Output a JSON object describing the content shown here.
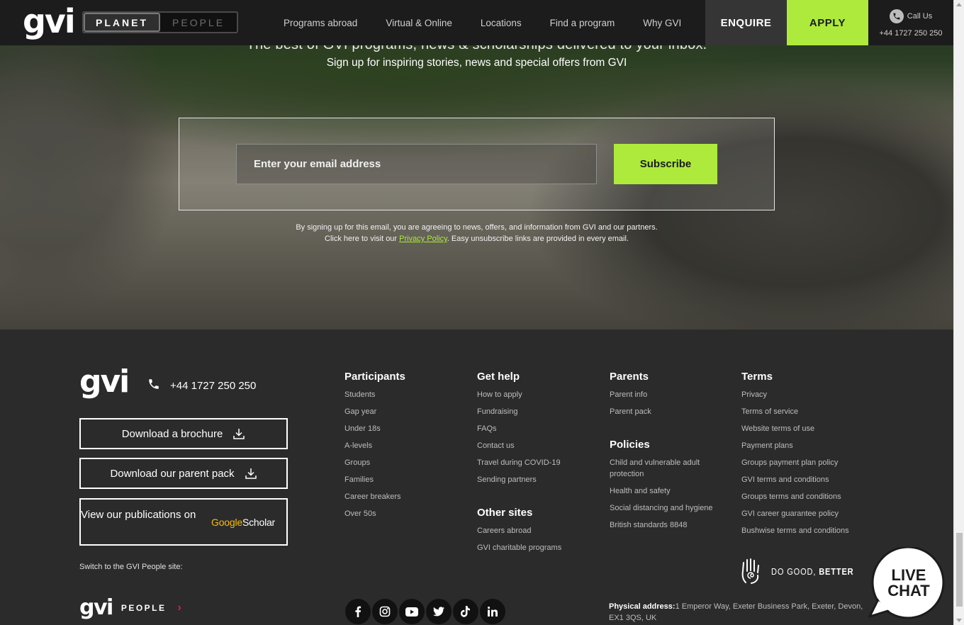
{
  "header": {
    "logo": "gvi",
    "toggle": {
      "active": "PLANET",
      "inactive": "PEOPLE"
    },
    "nav": [
      "Programs abroad",
      "Virtual & Online",
      "Locations",
      "Find a program",
      "Why GVI"
    ],
    "enquire": "ENQUIRE",
    "apply": "APPLY",
    "call_label": "Call Us",
    "call_number": "+44 1727 250 250"
  },
  "hero": {
    "title": "The best of GVI programs, news & scholarships delivered to your inbox.",
    "subtitle": "Sign up for inspiring stories, news and special offers from GVI",
    "email_placeholder": "Enter your email address",
    "subscribe": "Subscribe",
    "legal_line1": "By signing up for this email, you are agreeing to news, offers, and information from GVI and our partners.",
    "legal_line2_pre": "Click here to visit our",
    "privacy_link": "Privacy Policy",
    "legal_line2_post": ". Easy unsubscribe links are provided in every email."
  },
  "footer": {
    "logo": "gvi",
    "phone": "+44 1727 250 250",
    "brochure_btn": "Download a brochure",
    "parent_pack_btn": "Download our parent pack",
    "publications_text": "View our publications on",
    "scholar_google": "Google",
    "scholar_word": "Scholar",
    "switch_label": "Switch to the GVI People site:",
    "people_logo": "gvi",
    "people_text": "PEOPLE",
    "columns": {
      "participants": {
        "title": "Participants",
        "links": [
          "Students",
          "Gap year",
          "Under 18s",
          "A-levels",
          "Groups",
          "Families",
          "Career breakers",
          "Over 50s"
        ]
      },
      "get_help": {
        "title": "Get help",
        "links": [
          "How to apply",
          "Fundraising",
          "FAQs",
          "Contact us",
          "Travel during COVID-19",
          "Sending partners"
        ]
      },
      "other_sites": {
        "title": "Other sites",
        "links": [
          "Careers abroad",
          "GVI charitable programs"
        ]
      },
      "parents": {
        "title": "Parents",
        "links": [
          "Parent info",
          "Parent pack"
        ]
      },
      "policies": {
        "title": "Policies",
        "links": [
          "Child and vulnerable adult protection",
          "Health and safety",
          "Social distancing and hygiene",
          "British standards 8848"
        ]
      },
      "terms": {
        "title": "Terms",
        "links": [
          "Privacy",
          "Terms of service",
          "Website terms of use",
          "Payment plans",
          "Groups payment plan policy",
          "GVI terms and conditions",
          "Groups terms and conditions",
          "GVI career guarantee policy",
          "Bushwise terms and conditions"
        ]
      }
    },
    "socials": [
      "f",
      "ig",
      "yt",
      "tw",
      "tt",
      "in"
    ],
    "dogood_1": "DO GOOD,",
    "dogood_2": "BETTER",
    "address_label": "Physical address:",
    "address": "1 Emperor Way, Exeter Business Park, Exeter, Devon, EX1 3QS, UK"
  },
  "livechat": {
    "line1": "LIVE",
    "line2": "CHAT"
  },
  "colors": {
    "accent": "#aeea3c",
    "header_bg": "#1c1c1c",
    "footer_bg": "#2b2b2b",
    "people_chevron": "#e0223f"
  }
}
